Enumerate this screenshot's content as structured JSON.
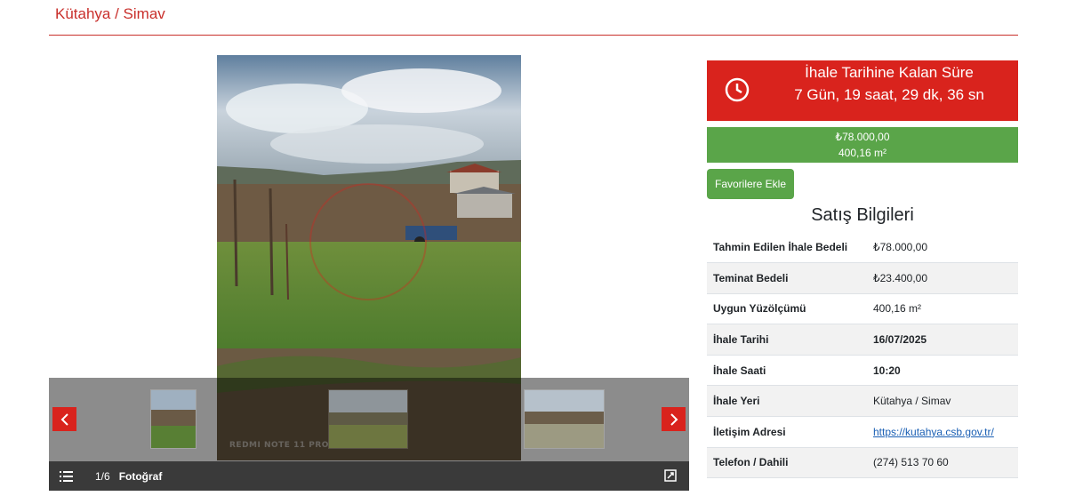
{
  "header": {
    "title": "Kütahya / Simav"
  },
  "gallery": {
    "watermark": "REDMI NOTE 11 PRO",
    "counter": "1/6",
    "label": "Fotoğraf",
    "prev_icon": "chevron-left-icon",
    "next_icon": "chevron-right-icon",
    "list_icon": "list-icon",
    "fullscreen_icon": "fullscreen-icon"
  },
  "countdown": {
    "label": "İhale Tarihine Kalan Süre",
    "value": "7 Gün, 19 saat, 29 dk, 36 sn",
    "icon": "clock-icon"
  },
  "price": {
    "amount": "₺78.000,00",
    "area": "400,16 m²"
  },
  "favorite_button": "Favorilere Ekle",
  "sales_info": {
    "title": "Satış Bilgileri",
    "rows": [
      {
        "key": "Tahmin Edilen İhale Bedeli",
        "value": "₺78.000,00"
      },
      {
        "key": "Teminat Bedeli",
        "value": "₺23.400,00"
      },
      {
        "key": "Uygun Yüzölçümü",
        "value": "400,16 m²"
      },
      {
        "key": "İhale Tarihi",
        "value": "16/07/2025"
      },
      {
        "key": "İhale Saati",
        "value": "10:20"
      },
      {
        "key": "İhale Yeri",
        "value": "Kütahya / Simav"
      },
      {
        "key": "İletişim Adresi",
        "value": "https://kutahya.csb.gov.tr/"
      },
      {
        "key": "Telefon / Dahili",
        "value": "(274) 513 70 60"
      }
    ]
  },
  "colors": {
    "brand_red": "#d9231d",
    "green": "#5aa549",
    "header_red": "#c9302c"
  }
}
